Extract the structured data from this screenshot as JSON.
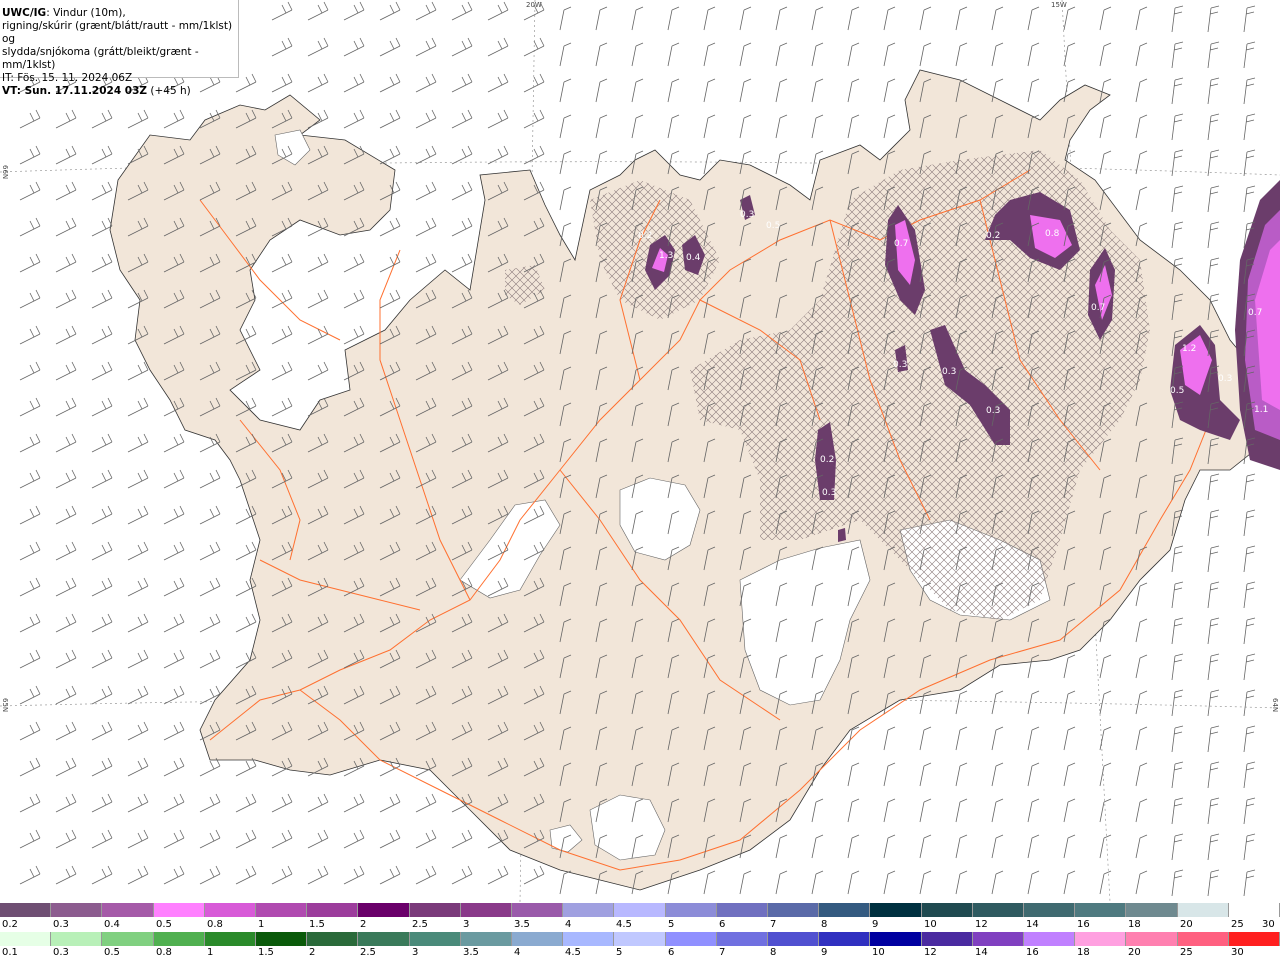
{
  "header": {
    "title_bold": "UWC/IG",
    "line1": ": Vindur (10m),",
    "line2": "rigning/skúrir (grænt/blátt/rautt - mm/1klst) og",
    "line3": "slydda/snjókoma (grátt/bleikt/grænt - mm/1klst)",
    "line4": "IT: Fös. 15. 11. 2024 06Z",
    "line5_bold": "VT: Sun. 17.11.2024 03Z",
    "line5_rest": " (+45 h)"
  },
  "coords": {
    "top_left": "20W",
    "top_right": "15W",
    "left_upper": "66N",
    "left_lower": "65N",
    "right_lower": "64N"
  },
  "map_labels": [
    "0.2",
    "1.3",
    "0.4",
    "0.3",
    "0.5",
    "0.7",
    "0.2",
    "0.8",
    "0.7",
    "1.2",
    "0.5",
    "0.3",
    "0.7",
    "1.1",
    "0.3",
    "0.3",
    "0.3",
    "0.2",
    "0.3"
  ],
  "colors": {
    "land": "#f2e6d9",
    "road": "#ff7030",
    "glacier": "#ffffff",
    "sea": "#ffffff",
    "snow_dark": "#6b3d6b",
    "snow_mid": "#b95cc6",
    "snow_light": "#ee70ee"
  },
  "legend": {
    "snow_colors": [
      "#6f4f73",
      "#8c5c8f",
      "#a55aa8",
      "#ff80ff",
      "#d85ad8",
      "#b04ab0",
      "#9c3c9c",
      "#6a006a",
      "#7a3a7a",
      "#8a3a8a",
      "#9a5aaa",
      "#a0a0e0",
      "#b8b8ff",
      "#8c8cd8",
      "#7070c0",
      "#5a6aa8",
      "#345a80",
      "#003040",
      "#1f4a50",
      "#2f5a60",
      "#3f6a70",
      "#4f7a80",
      "#6f8a90",
      "#d8e6e8",
      "#ffffff"
    ],
    "snow_labels": [
      "0.2",
      "0.3",
      "0.4",
      "0.5",
      "0.8",
      "1",
      "1.5",
      "2",
      "2.5",
      "3",
      "3.5",
      "4",
      "4.5",
      "5",
      "6",
      "7",
      "8",
      "9",
      "10",
      "12",
      "14",
      "16",
      "18",
      "20",
      "25",
      "30"
    ],
    "rain_colors": [
      "#e6ffe6",
      "#b8f0b8",
      "#80d080",
      "#50b050",
      "#2a8a2a",
      "#0a5a0a",
      "#2a6a3a",
      "#3a7a5a",
      "#4a8a7a",
      "#6a9aa0",
      "#8aaad0",
      "#a8b8ff",
      "#c0c8ff",
      "#9090ff",
      "#7070e0",
      "#5050d0",
      "#3030c0",
      "#0000a0",
      "#4a2aa0",
      "#8040c0",
      "#c080ff",
      "#ffa0e0",
      "#ff80b0",
      "#ff6080",
      "#ff2020"
    ],
    "rain_labels": [
      "0.1",
      "0.3",
      "0.5",
      "0.8",
      "1",
      "1.5",
      "2",
      "2.5",
      "3",
      "3.5",
      "4",
      "4.5",
      "5",
      "6",
      "7",
      "8",
      "9",
      "10",
      "12",
      "14",
      "16",
      "18",
      "20",
      "25",
      "30"
    ]
  }
}
